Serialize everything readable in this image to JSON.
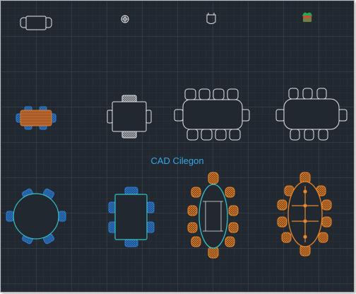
{
  "caption": {
    "text": "CAD Cilegon"
  },
  "colors": {
    "background": "#212830",
    "line_white": "#e8e8e8",
    "chair_blue": "#2f7fd6",
    "table_cyan": "#34c3c8",
    "chair_orange": "#e8862c",
    "table_brown": "#b5652c",
    "accent_green": "#2aa84a",
    "accent_red": "#e0403a",
    "caption_blue": "#35a8e8"
  },
  "blocks": [
    {
      "name": "dining-table-with-2-chairs-plan",
      "color": "white"
    },
    {
      "name": "round-stool-plan",
      "color": "white"
    },
    {
      "name": "chair-front-view",
      "color": "white"
    },
    {
      "name": "potted-plant-icon",
      "color": "green"
    },
    {
      "name": "table-6-seat-filled",
      "color": "brown-blue"
    },
    {
      "name": "square-table-2-chairs",
      "color": "white"
    },
    {
      "name": "conference-table-10-chairs",
      "color": "white"
    },
    {
      "name": "conference-table-10-chairs-alt",
      "color": "white"
    },
    {
      "name": "round-table-6-chairs",
      "color": "blue-cyan"
    },
    {
      "name": "rectangular-table-6-chairs",
      "color": "blue-cyan"
    },
    {
      "name": "oval-table-10-chairs",
      "color": "orange-cyan"
    },
    {
      "name": "oval-table-10-chairs-orange",
      "color": "orange"
    }
  ]
}
